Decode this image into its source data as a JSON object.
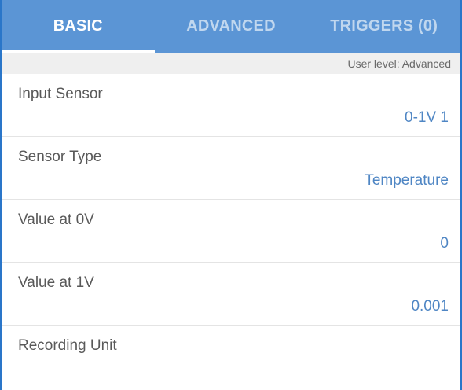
{
  "tabs": [
    {
      "label": "BASIC",
      "active": true
    },
    {
      "label": "ADVANCED",
      "active": false
    },
    {
      "label": "TRIGGERS (0)",
      "active": false
    }
  ],
  "user_level": "User level: Advanced",
  "settings": [
    {
      "label": "Input Sensor",
      "value": "0-1V 1"
    },
    {
      "label": "Sensor Type",
      "value": "Temperature"
    },
    {
      "label": "Value at 0V",
      "value": "0"
    },
    {
      "label": "Value at 1V",
      "value": "0.001"
    },
    {
      "label": "Recording Unit",
      "value": ""
    }
  ],
  "colors": {
    "tab_bar": "#5b95d5",
    "value_text": "#4f86c4",
    "frame_border": "#2a76c9"
  }
}
